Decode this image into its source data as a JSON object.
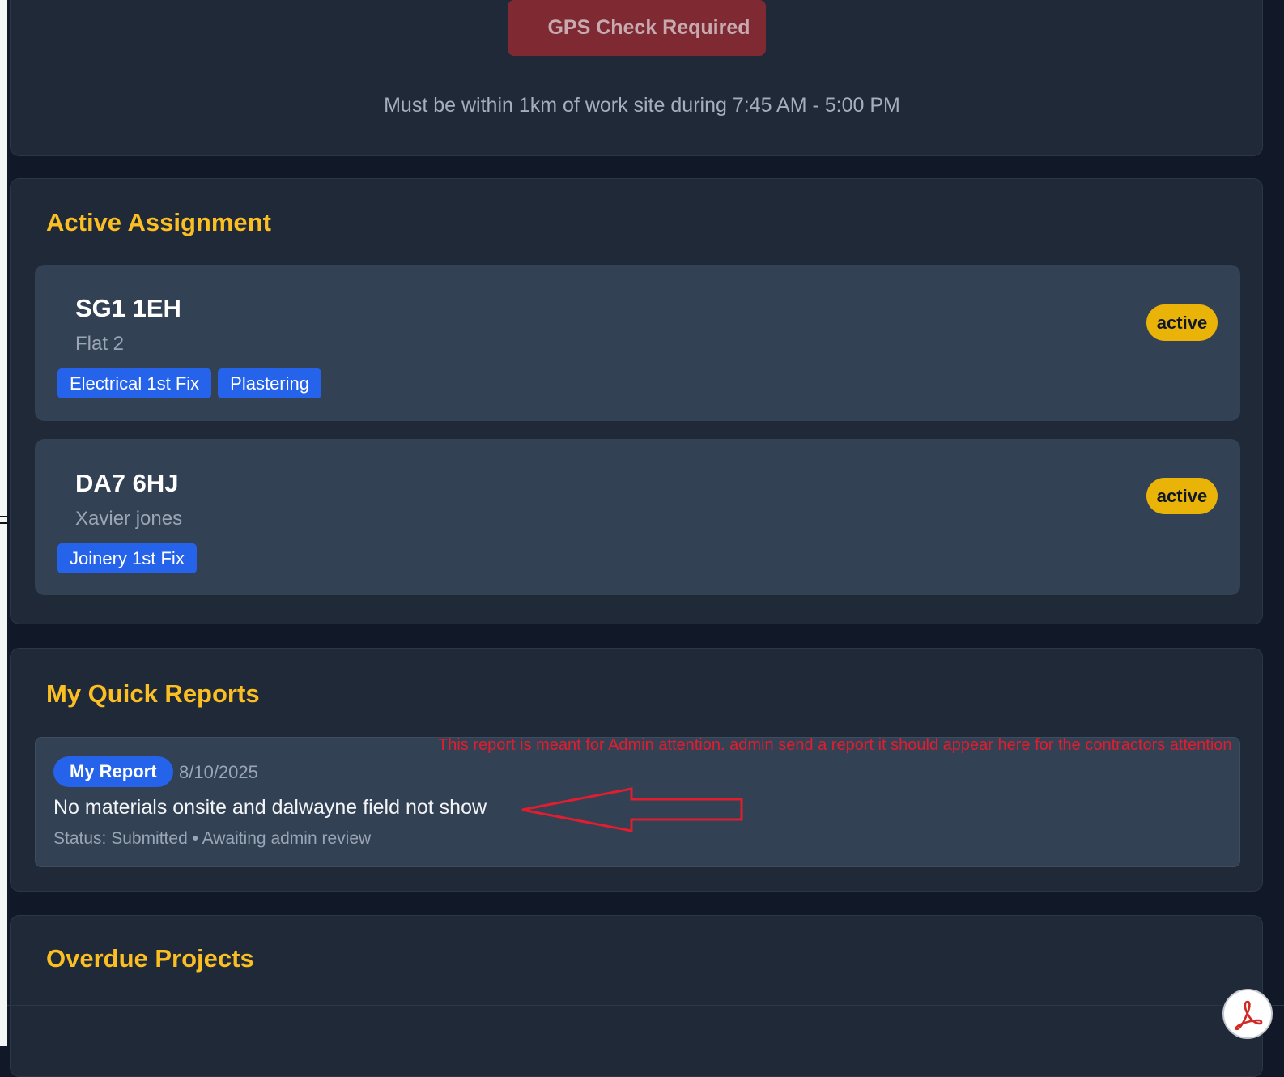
{
  "gps": {
    "button_label": "GPS Check Required",
    "note": "Must be within 1km of work site during 7:45 AM - 5:00 PM"
  },
  "assignments": {
    "title": "Active Assignment",
    "items": [
      {
        "code": "SG1 1EH",
        "sub": "Flat 2",
        "tags": [
          "Electrical 1st Fix",
          "Plastering"
        ],
        "status": "active"
      },
      {
        "code": "DA7 6HJ",
        "sub": "Xavier jones",
        "tags": [
          "Joinery 1st Fix"
        ],
        "status": "active"
      }
    ]
  },
  "reports": {
    "title": "My Quick Reports",
    "items": [
      {
        "tag": "My Report",
        "date": "8/10/2025",
        "text": "No materials onsite and dalwayne field not show",
        "status": "Status: Submitted • Awaiting admin review"
      }
    ]
  },
  "annotation": {
    "text": "This report is meant for Admin attention. admin send a report it should appear here for the contractors attention",
    "color": "#e11d2e"
  },
  "overdue": {
    "title": "Overdue Projects"
  },
  "icons": {
    "pdf": "pdf-icon"
  },
  "colors": {
    "background": "#111827",
    "card": "#1f2937",
    "item": "#334155",
    "accent_title": "#fbbf24",
    "tag": "#2563eb",
    "badge": "#eab308",
    "gps_button": "#7f2a33"
  }
}
